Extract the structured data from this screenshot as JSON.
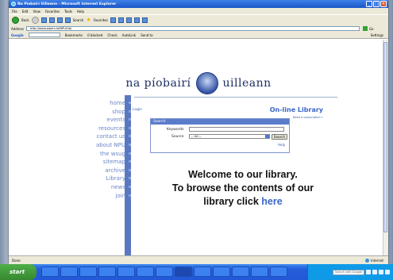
{
  "window": {
    "title": "Na Píobairí Uilleann - Microsoft Internet Explorer",
    "menu": [
      "File",
      "Edit",
      "View",
      "Favorites",
      "Tools",
      "Help"
    ],
    "toolbar": {
      "back_label": "Back",
      "search_label": "Search",
      "favorites_label": "Favorites"
    },
    "address_label": "Address",
    "address_url": "http://www.pipers.ie/NPU/Lib/",
    "go_label": "Go",
    "googlebar": {
      "brand": "Google",
      "bookmarks": "Bookmarks",
      "blocked": "0 blocked",
      "check": "Check",
      "autolink": "AutoLink",
      "sendto": "Send to",
      "settings": "Settings"
    },
    "status": {
      "left": "Done",
      "zone": "Internet"
    }
  },
  "page": {
    "site_name_left": "na píobairí",
    "site_name_right": "uilleann",
    "nav": [
      "home",
      "shop",
      "events",
      "resources",
      "contact us",
      "about NPU",
      "the wsug",
      "sitemap",
      "archive",
      "Library",
      "news",
      "join"
    ],
    "login_label": "Login",
    "library_title": "On-line Library",
    "signup_text": "Need a subscription »",
    "search": {
      "header": "Search",
      "keywords_label": "Keywords",
      "keywords_value": "",
      "source_label": "Source",
      "source_value": "-- All --",
      "search_button": "Search",
      "help_link": "Help"
    },
    "welcome_line1": "Welcome to our library.",
    "welcome_line2": "To browse the contents of our",
    "welcome_line3": "library click",
    "welcome_link": "here"
  },
  "taskbar": {
    "start_label": "start",
    "search_placeholder": "Search with Google"
  }
}
